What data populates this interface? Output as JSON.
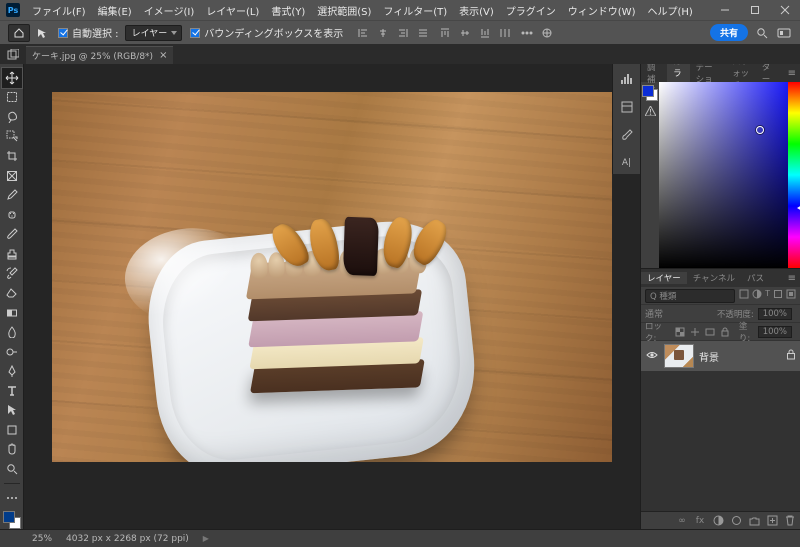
{
  "window": {
    "minimize": "—",
    "maximize": "☐",
    "close": "✕"
  },
  "menu": {
    "file": "ファイル(F)",
    "edit": "編集(E)",
    "image": "イメージ(I)",
    "layer": "レイヤー(L)",
    "type": "書式(Y)",
    "select": "選択範囲(S)",
    "filter": "フィルター(T)",
    "view": "表示(V)",
    "plugin": "プラグイン",
    "windowM": "ウィンドウ(W)",
    "help": "ヘルプ(H)"
  },
  "options": {
    "auto_select": "自動選択 :",
    "target": "レイヤー",
    "show_bbx": "バウンディングボックスを表示",
    "share": "共有"
  },
  "tab": {
    "title": "ケーキ.jpg @ 25% (RGB/8*)"
  },
  "dock": {
    "a": "",
    "b": "",
    "c": "",
    "d": "A|"
  },
  "color_tabs": {
    "correction": "色調補正",
    "color": "カラー",
    "gradient": "グラデーション",
    "swatch": "スウォッチ",
    "pattern": "パターン"
  },
  "layers_tabs": {
    "layers": "レイヤー",
    "channels": "チャンネル",
    "paths": "パス"
  },
  "layers": {
    "search_placeholder": "Q 種類",
    "opacity_label": "不透明度:",
    "opacity_val": "100%",
    "blend_label": "通常",
    "lock_label": "ロック:",
    "fill_label": "塗り:",
    "fill_val": "100%",
    "bg_layer": "背景"
  },
  "status": {
    "zoom": "25%",
    "dims": "4032 px x 2268 px (72 ppi)"
  },
  "footer_icons": {
    "link": "∞",
    "fx": "fx",
    "mask": "◐",
    "adj": "●",
    "group": "▢",
    "new": "⊞",
    "trash": "🗑"
  }
}
